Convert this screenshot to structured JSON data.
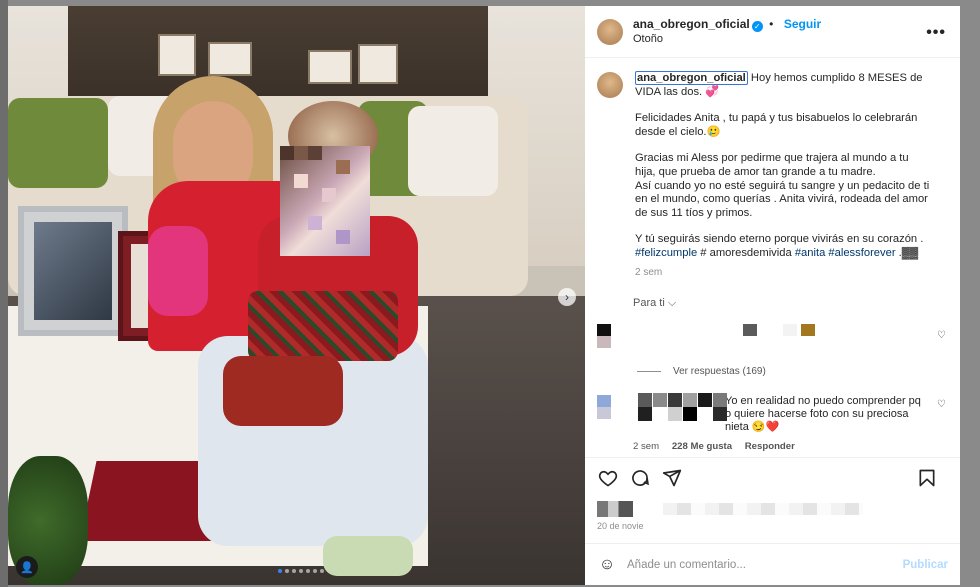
{
  "post": {
    "username": "ana_obregon_oficial",
    "verified_mark": "✓",
    "separator": "•",
    "follow_label": "Seguir",
    "location": "Otoño",
    "more_label": "•••"
  },
  "caption": {
    "username": "ana_obregon_oficial",
    "line1_text": "Hoy hemos cumplido 8 MESES de VIDA las dos. 💞",
    "p2": "Felicidades Anita , tu papá y tus bisabuelos lo celebrarán desde el cielo.🥲",
    "p3": "Gracias mi Aless por pedirme que trajera al mundo a tu hija, que prueba de amor tan grande a tu madre.",
    "p4": "Así cuando yo no esté seguirá tu sangre y un pedacito de ti en el mundo, como querías . Anita vivirá, rodeada del amor de sus 11 tíos y primos.",
    "p5_text": "Y tú seguirás siendo eterno porque vivirás en su corazón .",
    "tag1": "#felizcumple",
    "hash_text": " # amoresdemivida ",
    "tag2": "#anita",
    "tag3": "#alessforever",
    "tail": " .▓▓",
    "time": "2 sem"
  },
  "sort": {
    "label": "Para ti",
    "chevron": "⌵"
  },
  "comment1": {
    "heart": "♡",
    "replies_label": "Ver respuestas (169)"
  },
  "comment2": {
    "text": "Yo en realidad no puedo comprender pq o quiere hacerse foto con su preciosa nieta 😏❤️",
    "time": "2 sem",
    "likes": "228 Me gusta",
    "reply_label": "Responder",
    "heart": "♡"
  },
  "footer": {
    "date": "20 de novie",
    "comment_placeholder": "Añade un comentario...",
    "publish_label": "Publicar",
    "emoji": "☺"
  },
  "photo": {
    "next_label": "›",
    "user_tag": "👤"
  }
}
